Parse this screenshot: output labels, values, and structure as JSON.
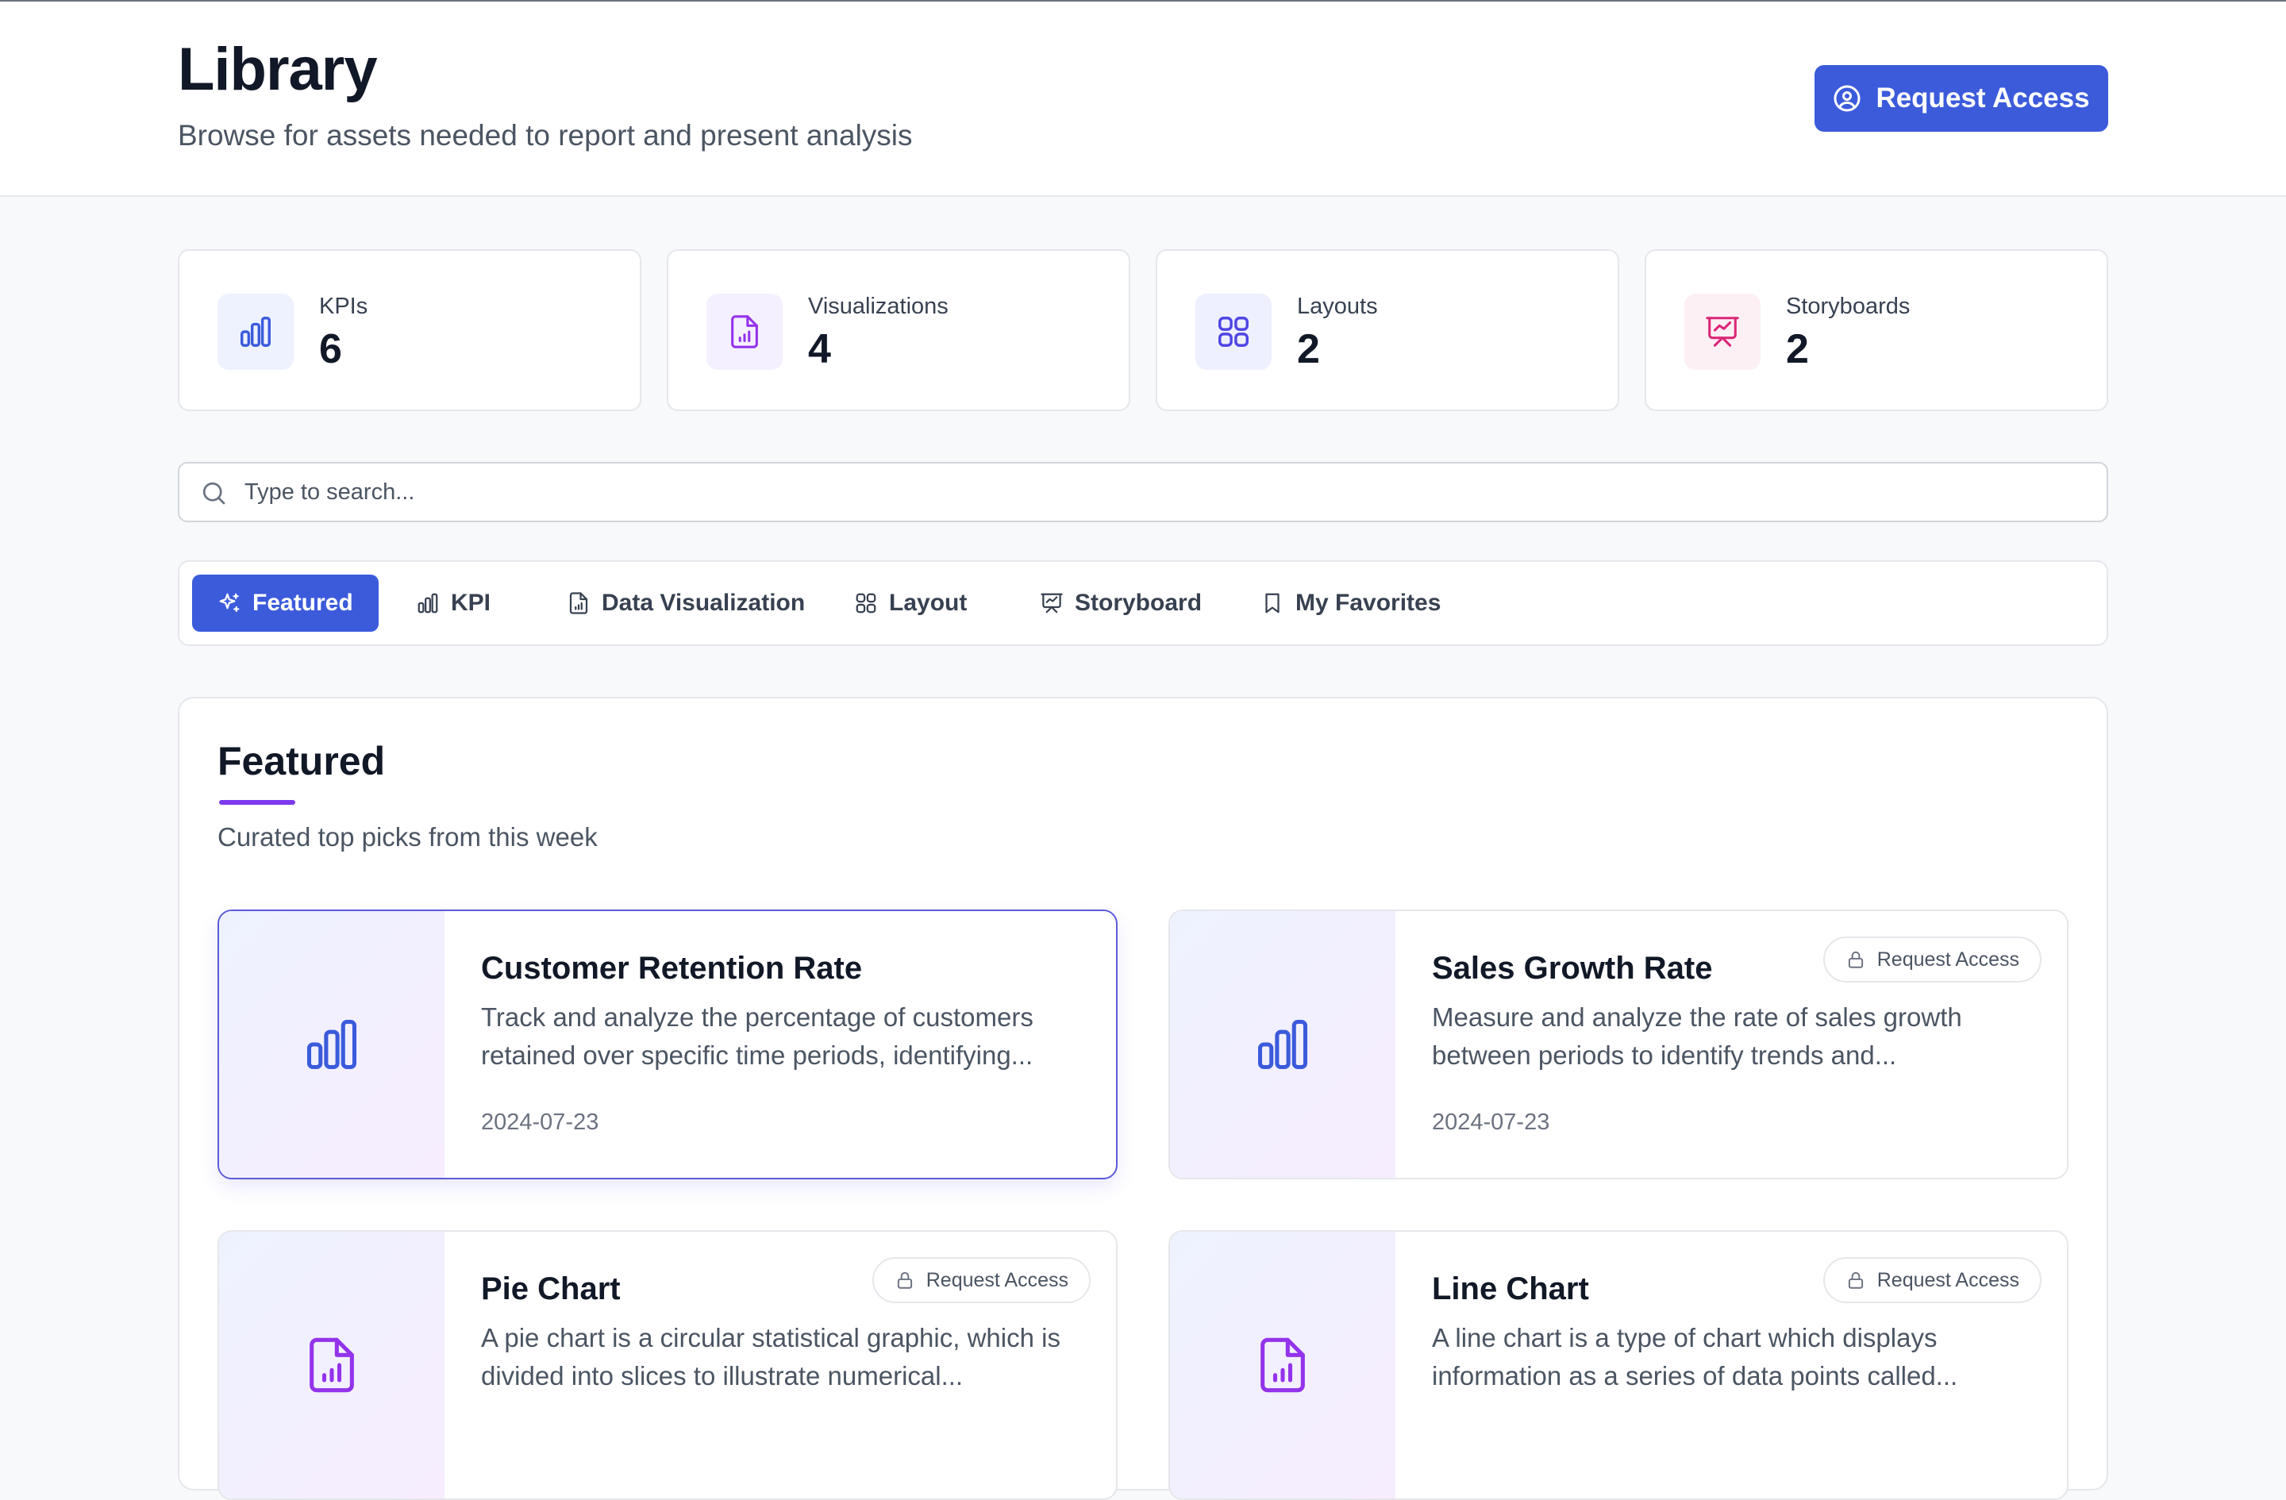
{
  "header": {
    "title": "Library",
    "subtitle": "Browse for assets needed to report and present analysis",
    "request_access_label": "Request Access"
  },
  "stats": [
    {
      "label": "KPIs",
      "value": "6",
      "icon": "bar-chart-icon",
      "icon_color": "#3b5bdb",
      "icon_bg": "#eef2ff"
    },
    {
      "label": "Visualizations",
      "value": "4",
      "icon": "file-chart-icon",
      "icon_color": "#9333ea",
      "icon_bg": "#f5f0ff"
    },
    {
      "label": "Layouts",
      "value": "2",
      "icon": "grid-icon",
      "icon_color": "#4f46e5",
      "icon_bg": "#eef0ff"
    },
    {
      "label": "Storyboards",
      "value": "2",
      "icon": "presentation-icon",
      "icon_color": "#db2777",
      "icon_bg": "#fdf0f5"
    }
  ],
  "search": {
    "placeholder": "Type to search...",
    "value": ""
  },
  "tabs": [
    {
      "label": "Featured",
      "icon": "sparkles-icon",
      "active": true
    },
    {
      "label": "KPI",
      "icon": "bar-chart-icon"
    },
    {
      "label": "Data Visualization",
      "icon": "file-chart-icon"
    },
    {
      "label": "Layout",
      "icon": "grid-icon"
    },
    {
      "label": "Storyboard",
      "icon": "presentation-icon"
    },
    {
      "label": "My Favorites",
      "icon": "bookmark-icon"
    }
  ],
  "featured": {
    "title": "Featured",
    "subtitle": "Curated top picks from this week",
    "items": [
      {
        "title": "Customer Retention Rate",
        "description": "Track and analyze the percentage of customers retained over specific time periods, identifying...",
        "date": "2024-07-23",
        "icon": "bar-chart-icon"
      },
      {
        "title": "Sales Growth Rate",
        "description": "Measure and analyze the rate of sales growth between periods to identify trends and...",
        "date": "2024-07-23",
        "icon": "bar-chart-icon",
        "request_access_label": "Request Access"
      },
      {
        "title": "Pie Chart",
        "description": "A pie chart is a circular statistical graphic, which is divided into slices to illustrate numerical...",
        "icon": "file-chart-icon",
        "request_access_label": "Request Access"
      },
      {
        "title": "Line Chart",
        "description": "A line chart is a type of chart which displays information as a series of data points called...",
        "icon": "file-chart-icon",
        "request_access_label": "Request Access"
      }
    ]
  },
  "colors": {
    "accent": "#3b5bdb",
    "underline": "#7c3aed",
    "kpi_icon": "#3b5bdb",
    "viz_icon": "#9333ea"
  }
}
